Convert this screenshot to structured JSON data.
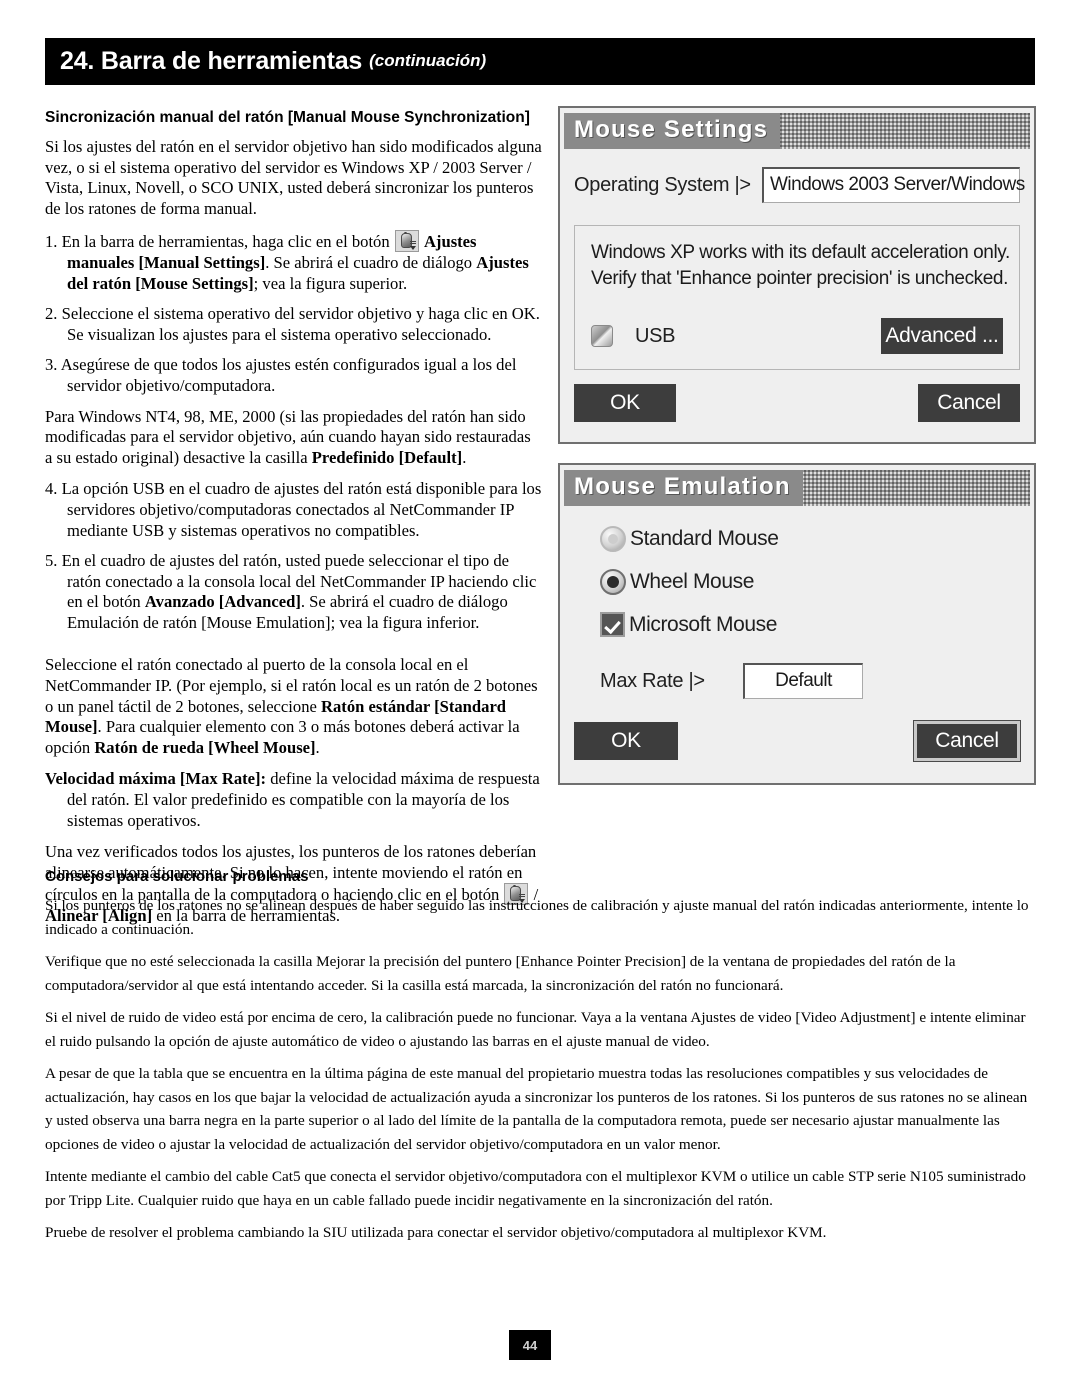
{
  "header": {
    "title": "24. Barra de herramientas",
    "subtitle": "(continuación)"
  },
  "left_column": {
    "section_heading": "Sincronización manual del ratón [Manual Mouse Synchronization]",
    "intro_paragraph": "Si los ajustes del ratón en el servidor objetivo han sido modificados alguna vez, o si el sistema operativo del servidor es Windows XP / 2003 Server / Vista, Linux, Novell, o SCO UNIX, usted deberá sincronizar los punteros de los ratones de forma manual.",
    "step1_number": "1.",
    "step1_pre": "En la barra de herramientas, haga clic en el botón ",
    "step1_bold1": "Ajustes manuales [Manual Settings]",
    "step1_mid": ". Se abrirá el cuadro de diálogo ",
    "step1_bold2": "Ajustes del ratón [Mouse Settings]",
    "step1_post": "; vea la figura superior.",
    "step2_number": "2.",
    "step2_text": "Seleccione el sistema operativo del servidor objetivo y haga clic en OK. Se visualizan los ajustes para el sistema operativo seleccionado.",
    "step3_number": "3.",
    "step3_text": "Asegúrese de que todos los ajustes estén configurados igual a los del servidor objetivo/computadora.",
    "nt4_pre": "Para Windows NT4, 98, ME, 2000 (si las propiedades del ratón han sido modificadas para el servidor objetivo, aún cuando hayan sido restauradas a su estado original) desactive la casilla ",
    "nt4_bold": "Predefinido [Default]",
    "nt4_post": ".",
    "step4_number": "4.",
    "step4_text": "La opción USB en el cuadro de ajustes del ratón está disponible para los servidores objetivo/computadoras conectados al NetCommander IP mediante USB y sistemas operativos no compatibles.",
    "step5_number": "5.",
    "step5_pre": "En el cuadro de ajustes del ratón, usted puede seleccionar el tipo de ratón conectado a la consola local del NetCommander IP haciendo clic en el botón ",
    "step5_bold": "Avanzado [Advanced]",
    "step5_post": ". Se abrirá el cuadro de diálogo Emulación de ratón [Mouse Emulation]; vea la figura inferior.",
    "select_pre": "Seleccione el ratón conectado al puerto de la consola local en el NetCommander IP. (Por ejemplo, si el ratón local es un ratón de 2 botones o un panel táctil de 2 botones, seleccione ",
    "select_bold1": "Ratón estándar [Standard Mouse]",
    "select_mid": ". Para cualquier elemento con 3 o más botones deberá activar la opción ",
    "select_bold2": "Ratón de rueda [Wheel Mouse]",
    "select_post": ".",
    "maxrate_bold": "Velocidad máxima [Max Rate]:",
    "maxrate_text": " define la velocidad máxima de respuesta del ratón. El valor predefinido es compatible con la mayoría de los sistemas operativos.",
    "align_pre": "Una vez verificados todos los ajustes, los punteros de los ratones deberían alinearse automáticamente. Si no lo hacen, intente moviendo el ratón en círculos en la pantalla de la computadora o haciendo clic en el botón ",
    "align_slash": " / ",
    "align_bold": "Alinear [Align]",
    "align_post": " en la barra de herramientas."
  },
  "mouse_settings_dialog": {
    "title": "Mouse Settings",
    "os_label": "Operating System |>",
    "os_value": "Windows 2003 Server/Windows",
    "info_line1": "Windows XP works with its default acceleration only.",
    "info_line2": "Verify that 'Enhance pointer precision' is unchecked.",
    "usb_label": "USB",
    "advanced_button": "Advanced ...",
    "ok_button": "OK",
    "cancel_button": "Cancel"
  },
  "mouse_emulation_dialog": {
    "title": "Mouse Emulation",
    "option_standard": "Standard Mouse",
    "option_wheel": "Wheel Mouse",
    "option_microsoft": "Microsoft Mouse",
    "max_rate_label": "Max Rate |>",
    "max_rate_value": "Default",
    "ok_button": "OK",
    "cancel_button": "Cancel"
  },
  "bottom_section": {
    "heading": "Consejos para solucionar problemas",
    "para1": "Si los punteros de los ratones no se alinean después de haber seguido las instrucciones de calibración y ajuste manual del ratón indicadas anteriormente, intente lo indicado a continuación.",
    "para2": "Verifique que no esté seleccionada la casilla Mejorar la precisión del puntero [Enhance Pointer Precision] de la ventana de propiedades del ratón de la computadora/servidor al que está intentando acceder. Si la casilla está marcada, la sincronización del ratón no funcionará.",
    "para3": "Si el nivel de ruido de video está por encima de cero, la calibración puede no funcionar. Vaya a la ventana Ajustes de video [Video Adjustment] e intente eliminar el ruido pulsando la opción de ajuste automático de video o ajustando las barras en el ajuste manual de video.",
    "para4": "A pesar de que la tabla que se encuentra en la última página de este manual del propietario muestra todas las resoluciones compatibles y sus velocidades de actualización, hay casos en los que bajar la velocidad de actualización ayuda a sincronizar los punteros de los ratones. Si los punteros de sus ratones no se alinean y usted observa una barra negra en la parte superior o al lado del límite de la pantalla de la computadora remota, puede ser necesario ajustar manualmente las opciones de video o ajustar la velocidad de actualización del servidor objetivo/computadora en un valor menor.",
    "para5": "Intente mediante el cambio del cable Cat5 que conecta el servidor objetivo/computadora con el multiplexor KVM o utilice un cable STP serie N105 suministrado por Tripp Lite. Cualquier ruido que haya en un cable fallado puede incidir negativamente en la sincronización del ratón.",
    "para6": "Pruebe de resolver el problema cambiando la SIU utilizada para conectar el servidor objetivo/computadora al multiplexor KVM."
  },
  "footer": {
    "page_number": "44"
  }
}
